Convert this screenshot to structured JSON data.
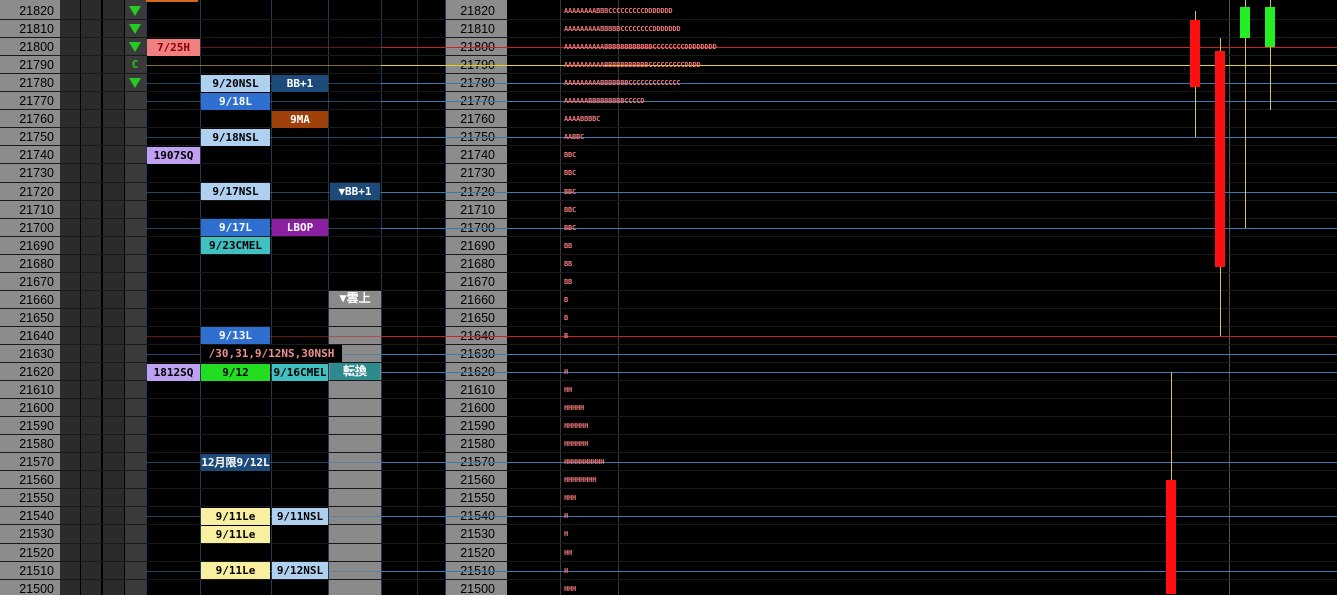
{
  "prices": [
    21820,
    21810,
    21800,
    21790,
    21780,
    21770,
    21760,
    21750,
    21740,
    21730,
    21720,
    21710,
    21700,
    21690,
    21680,
    21670,
    21660,
    21650,
    21640,
    21630,
    21620,
    21610,
    21600,
    21590,
    21580,
    21570,
    21560,
    21550,
    21540,
    21530,
    21520,
    21510,
    21500
  ],
  "signals": [
    {
      "price": 21820,
      "type": "down-triangle"
    },
    {
      "price": 21810,
      "type": "down-triangle"
    },
    {
      "price": 21800,
      "type": "down-triangle"
    },
    {
      "price": 21790,
      "type": "text",
      "text": "C"
    },
    {
      "price": 21780,
      "type": "down-triangle"
    }
  ],
  "labels": [
    {
      "price": 21800,
      "col": "a",
      "text": "7/25H",
      "bg": "#f08080",
      "fg": "#8b0000"
    },
    {
      "price": 21780,
      "col": "b",
      "text": "9/20NSL",
      "bg": "#b0d0f0",
      "fg": "#000"
    },
    {
      "price": 21780,
      "col": "c",
      "text": "BB+1",
      "bg": "#1e4a7a",
      "fg": "#fff"
    },
    {
      "price": 21770,
      "col": "b",
      "text": "9/18L",
      "bg": "#2f6fd0",
      "fg": "#fff"
    },
    {
      "price": 21760,
      "col": "c",
      "text": "9MA",
      "bg": "#a0400a",
      "fg": "#fff"
    },
    {
      "price": 21750,
      "col": "b",
      "text": "9/18NSL",
      "bg": "#b0d0f0",
      "fg": "#000"
    },
    {
      "price": 21740,
      "col": "a",
      "text": "1907SQ",
      "bg": "#c0a0f0",
      "fg": "#000"
    },
    {
      "price": 21720,
      "col": "b",
      "text": "9/17NSL",
      "bg": "#b0d0f0",
      "fg": "#000"
    },
    {
      "price": 21720,
      "col": "d",
      "text": "▼BB+1",
      "bg": "#1e4a7a",
      "fg": "#fff"
    },
    {
      "price": 21700,
      "col": "b",
      "text": "9/17L",
      "bg": "#2f6fd0",
      "fg": "#fff"
    },
    {
      "price": 21700,
      "col": "c",
      "text": "LBOP",
      "bg": "#8a1fa0",
      "fg": "#fff"
    },
    {
      "price": 21690,
      "col": "b",
      "text": "9/23CMEL",
      "bg": "#40c0c0",
      "fg": "#000"
    },
    {
      "price": 21640,
      "col": "b",
      "text": "9/13L",
      "bg": "#2f6fd0",
      "fg": "#fff"
    },
    {
      "price": 21630,
      "col": "bc",
      "text": "/30,31,9/12NS,30NSH",
      "bg": "#000",
      "fg": "#f09090"
    },
    {
      "price": 21620,
      "col": "a",
      "text": "1812SQ",
      "bg": "#c0a0f0",
      "fg": "#000"
    },
    {
      "price": 21620,
      "col": "b",
      "text": "9/12",
      "bg": "#22dd22",
      "fg": "#000"
    },
    {
      "price": 21620,
      "col": "c",
      "text": "9/16CMEL",
      "bg": "#40c0c0",
      "fg": "#000"
    },
    {
      "price": 21570,
      "col": "b",
      "text": "12月限9/12L",
      "bg": "#1e4a7a",
      "fg": "#fff"
    },
    {
      "price": 21540,
      "col": "b",
      "text": "9/11Le",
      "bg": "#f8f0a0",
      "fg": "#000"
    },
    {
      "price": 21540,
      "col": "c",
      "text": "9/11NSL",
      "bg": "#b0d0f0",
      "fg": "#000"
    },
    {
      "price": 21530,
      "col": "b",
      "text": "9/11Le",
      "bg": "#f8f0a0",
      "fg": "#000"
    },
    {
      "price": 21510,
      "col": "b",
      "text": "9/11Le",
      "bg": "#f8f0a0",
      "fg": "#000"
    },
    {
      "price": 21510,
      "col": "c",
      "text": "9/12NSL",
      "bg": "#b0d0f0",
      "fg": "#000"
    }
  ],
  "labels_special": {
    "kumo": "▼雲上",
    "tenkan": "転換"
  },
  "hlines": [
    {
      "price": 21800,
      "color": "#cc2020"
    },
    {
      "price": 21790,
      "color": "#e8d020"
    },
    {
      "price": 21780,
      "color": "#3a7ab0"
    },
    {
      "price": 21770,
      "color": "#3a7ab0"
    },
    {
      "price": 21750,
      "color": "#3a7ab0"
    },
    {
      "price": 21720,
      "color": "#3a7ab0"
    },
    {
      "price": 21700,
      "color": "#3a7ab0"
    },
    {
      "price": 21640,
      "color": "#cc2020"
    },
    {
      "price": 21630,
      "color": "#3a7ab0"
    },
    {
      "price": 21620,
      "color": "#3a7ab0"
    },
    {
      "price": 21570,
      "color": "#3a7ab0"
    },
    {
      "price": 21540,
      "color": "#3a7ab0"
    },
    {
      "price": 21510,
      "color": "#3a7ab0"
    }
  ],
  "tpo": [
    {
      "price": 21820,
      "text": "AAAAAAAABBBCCCCCCCCCDDDDDDD"
    },
    {
      "price": 21810,
      "text": "AAAAAAAAABBBBBCCCCCCCCDDDDDDD"
    },
    {
      "price": 21800,
      "text": "AAAAAAAAAABBBBBBBBBBBBCCCCCCCCDDDDDDDD"
    },
    {
      "price": 21790,
      "text": "AAAAAAAAAABBBBBBBBBBBCCCCCCCCCDDDD"
    },
    {
      "price": 21780,
      "text": "AAAAAAAAABBBBBBBCCCCCCCCCCCCC"
    },
    {
      "price": 21770,
      "text": "AAAAAABBBBBBBBBCCCCD"
    },
    {
      "price": 21760,
      "text": "AAAABBBBC"
    },
    {
      "price": 21750,
      "text": "AABBC"
    },
    {
      "price": 21740,
      "text": "BBC"
    },
    {
      "price": 21730,
      "text": "BBC"
    },
    {
      "price": 21720,
      "text": "BBC"
    },
    {
      "price": 21710,
      "text": "BBC"
    },
    {
      "price": 21700,
      "text": "BBC"
    },
    {
      "price": 21690,
      "text": "BB"
    },
    {
      "price": 21680,
      "text": "BB"
    },
    {
      "price": 21670,
      "text": "BB"
    },
    {
      "price": 21660,
      "text": "B"
    },
    {
      "price": 21650,
      "text": "B"
    },
    {
      "price": 21640,
      "text": "B"
    },
    {
      "price": 21620,
      "text": "H"
    },
    {
      "price": 21610,
      "text": "HH"
    },
    {
      "price": 21600,
      "text": "HHHHH"
    },
    {
      "price": 21590,
      "text": "HHHHHH"
    },
    {
      "price": 21580,
      "text": "HHHHHH"
    },
    {
      "price": 21570,
      "text": "HHHHHHHHHH"
    },
    {
      "price": 21560,
      "text": "HHHHHHHH"
    },
    {
      "price": 21550,
      "text": "HHH"
    },
    {
      "price": 21540,
      "text": "H"
    },
    {
      "price": 21530,
      "text": "H"
    },
    {
      "price": 21520,
      "text": "HH"
    },
    {
      "price": 21510,
      "text": "H"
    },
    {
      "price": 21500,
      "text": "HHH"
    }
  ],
  "candles": [
    {
      "open": 21560,
      "close": 21497,
      "high": 21620,
      "low": 21497,
      "color": "#ff1010"
    },
    {
      "open": 21815,
      "close": 21778,
      "high": 21820,
      "low": 21750,
      "color": "#ff1010"
    },
    {
      "open": 21798,
      "close": 21678,
      "high": 21805,
      "low": 21640,
      "color": "#ff1010"
    },
    {
      "open": 21805,
      "close": 21822,
      "high": 21826,
      "low": 21700,
      "color": "#22ee22"
    },
    {
      "open": 21800,
      "close": 21822,
      "high": 21826,
      "low": 21765,
      "color": "#22ee22"
    }
  ],
  "colors": {
    "price_axis_bg": "#8c8c8c",
    "tpo_text": "#f07878",
    "accent_red": "#cc2020",
    "accent_blue": "#3a7ab0"
  }
}
